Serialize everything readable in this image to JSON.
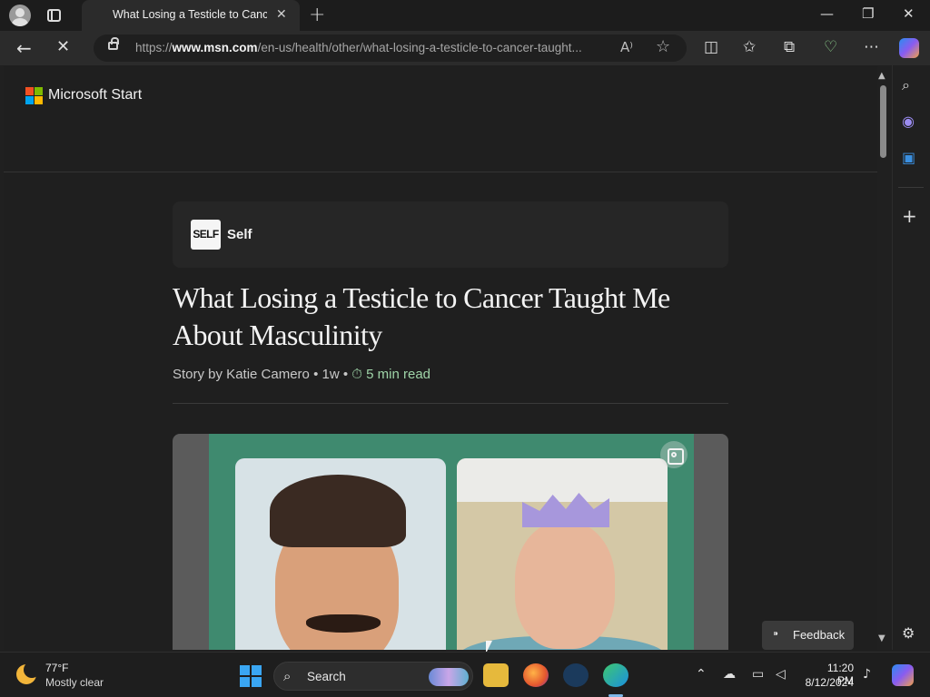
{
  "browser": {
    "tab_title": "What Losing a Testicle to Cancer Taught Me About Masculinity",
    "url_prefix": "https://",
    "url_domain": "www.msn.com",
    "url_path": "/en-us/health/other/what-losing-a-testicle-to-cancer-taught...",
    "read_aloud_icon": "A⁾",
    "icons": [
      "back-icon",
      "stop-loading-icon",
      "lock-icon",
      "favorite-star-icon",
      "split-screen-icon",
      "favorites-icon",
      "collections-icon",
      "browser-essentials-icon",
      "more-icon",
      "copilot-icon"
    ]
  },
  "site": {
    "brand": "Microsoft Start",
    "logo_colors": [
      "#f25022",
      "#7fba00",
      "#00a4ef",
      "#ffb900"
    ]
  },
  "article": {
    "source_logo": "SELF",
    "source_name": "Self",
    "headline": "What Losing a Testicle to Cancer Taught Me About Masculinity",
    "byline_prefix": "Story by Katie Camero",
    "age": "1w",
    "read_time": "5 min read"
  },
  "feedback": {
    "label": "Feedback"
  },
  "taskbar": {
    "weather_temp": "77°F",
    "weather_desc": "Mostly clear",
    "search_label": "Search",
    "time": "11:20 PM",
    "date": "8/12/2024"
  },
  "colors": {
    "accent_green": "#9fd4a8",
    "page_bg": "#1f1f1f"
  }
}
